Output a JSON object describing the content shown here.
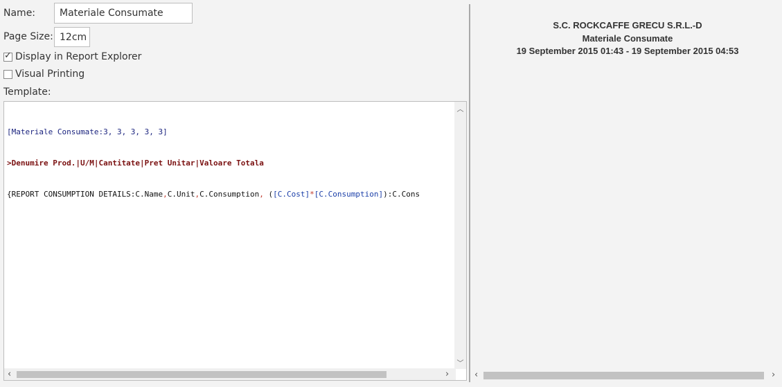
{
  "form": {
    "name_label": "Name:",
    "name_value": "Materiale Consumate",
    "pagesize_label": "Page Size:",
    "pagesize_value": "12cm",
    "display_in_explorer_label": "Display in Report Explorer",
    "display_in_explorer_checked": true,
    "visual_printing_label": "Visual Printing",
    "visual_printing_checked": false,
    "template_label": "Template:"
  },
  "template": {
    "line1": "[Materiale Consumate:3, 3, 3, 3, 3]",
    "line2": ">Denumire Prod.|U/M|Cantitate|Pret Unitar|Valoare Totala",
    "line3_a": "{REPORT CONSUMPTION DETAILS:C.Name",
    "line3_comma1": ",",
    "line3_b": "C.Unit",
    "line3_comma2": ",",
    "line3_c": "C.Consumption",
    "line3_comma3": ",",
    "line3_d": " (",
    "line3_e": "[C.Cost]",
    "line3_f": "*",
    "line3_g": "[C.Consumption]",
    "line3_h": "):C.Cons"
  },
  "preview": {
    "company": "S.C. ROCKCAFFE GRECU S.R.L.-D",
    "title": "Materiale Consumate",
    "period": "19 September 2015 01:43 - 19 September 2015 04:53"
  },
  "icons": {
    "scroll_up": "scroll-up-icon",
    "scroll_down": "scroll-down-icon",
    "scroll_left": "scroll-left-icon",
    "scroll_right": "scroll-right-icon"
  }
}
